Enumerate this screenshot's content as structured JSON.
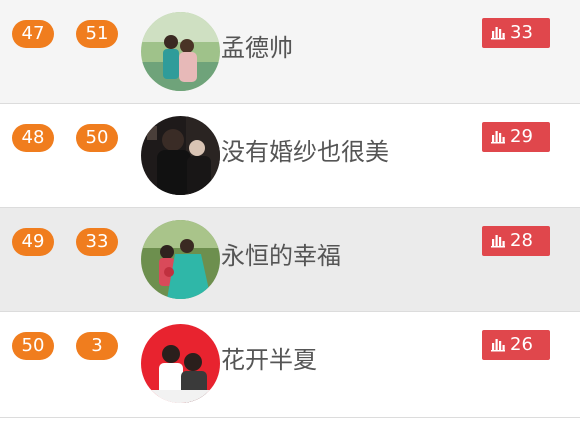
{
  "rows": [
    {
      "rank": "47",
      "number": "51",
      "name": "孟德帅",
      "votes": "33",
      "avatar": "couple-photo"
    },
    {
      "rank": "48",
      "number": "50",
      "name": "没有婚纱也很美",
      "votes": "29",
      "avatar": "couple-photo"
    },
    {
      "rank": "49",
      "number": "33",
      "name": "永恒的幸福",
      "votes": "28",
      "avatar": "couple-photo"
    },
    {
      "rank": "50",
      "number": "3",
      "name": "花开半夏",
      "votes": "26",
      "avatar": "couple-photo"
    }
  ],
  "vote_icon": "bar-chart-icon",
  "colors": {
    "pill": "#f07d1e",
    "vote_badge": "#e0474c",
    "name_text": "#555555"
  }
}
